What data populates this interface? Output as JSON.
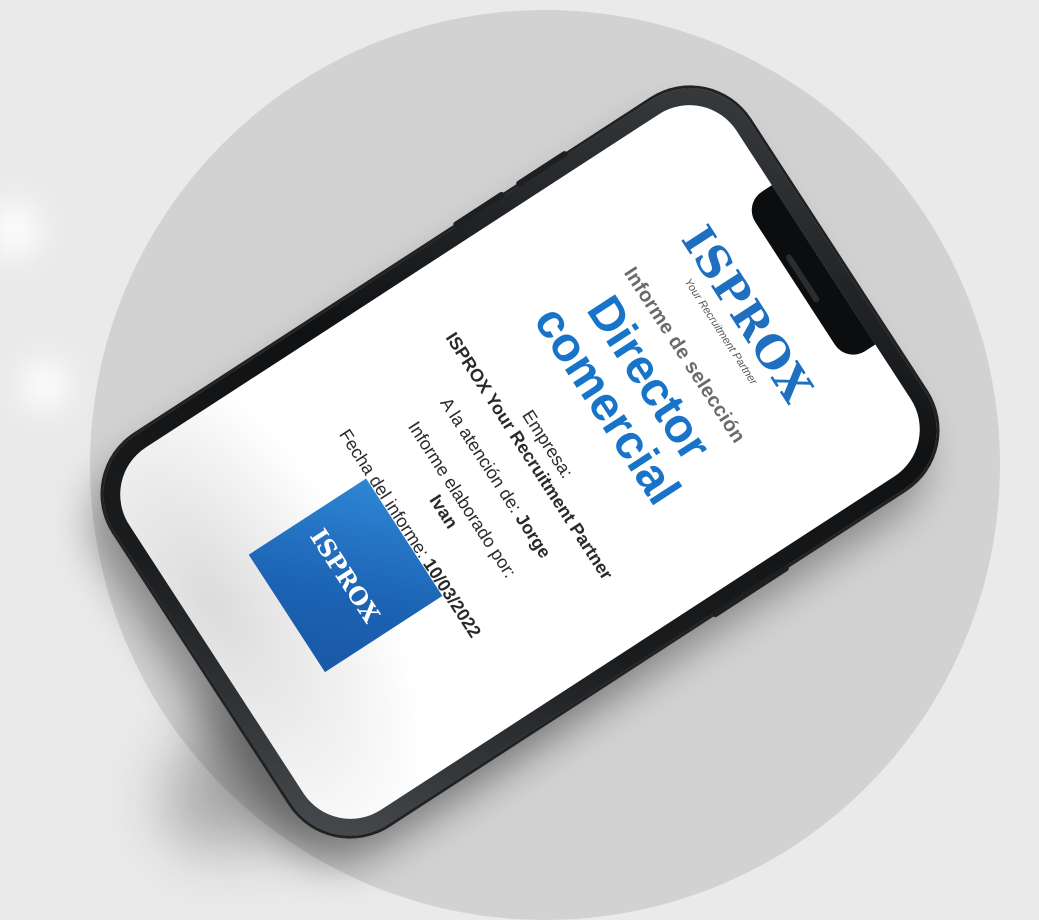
{
  "brand": {
    "logo_text": "ISPROX",
    "tagline": "Your Recruitment Partner",
    "badge_text": "ISPROX",
    "accent_color": "#1874c9"
  },
  "report": {
    "label": "Informe de selección",
    "job_title_line1": "Director",
    "job_title_line2": "comercial"
  },
  "fields": {
    "company_label": "Empresa:",
    "company_value": "ISPROX Your Recruitment Partner",
    "attention_label": "A la atención de:",
    "attention_value": "Jorge",
    "author_label": "Informe elaborado por:",
    "author_value": "Ivan",
    "date_label": "Fecha del informe:",
    "date_value": "10/03/2022"
  }
}
